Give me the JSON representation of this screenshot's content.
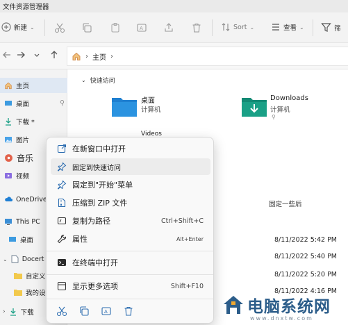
{
  "window": {
    "title": "文件资源管理器"
  },
  "toolbar": {
    "new_label": "新建",
    "sort_label": "Sort",
    "view_label": "查看",
    "filter_label": "筛"
  },
  "address": {
    "crumb": "主页"
  },
  "sidebar": {
    "items": [
      {
        "label": "主页"
      },
      {
        "label": "桌面"
      },
      {
        "label": "下载 *"
      },
      {
        "label": "图片"
      },
      {
        "label": "音乐"
      },
      {
        "label": "视频"
      },
      {
        "label": "OneDrive"
      },
      {
        "label": "This PC"
      },
      {
        "label": "桌面"
      },
      {
        "label": "Docert"
      },
      {
        "label": "自定义"
      },
      {
        "label": "我的设计信息"
      },
      {
        "label": "下载"
      }
    ]
  },
  "main": {
    "section": "快速访问",
    "quick_access": [
      {
        "name": "桌面",
        "sub": "计算机"
      },
      {
        "name": "Downloads",
        "sub": "计算机"
      },
      {
        "name": "Videos"
      }
    ],
    "list_header": "固定一些后",
    "dates": [
      "8/11/2022 5:42 PM",
      "8/11/2022 5:40 PM",
      "8/11/2022 5:20 PM",
      "8/11/2022 4:16 PM"
    ]
  },
  "context_menu": {
    "items": [
      {
        "label": "在新窗口中打开",
        "shortcut": ""
      },
      {
        "label": "固定到快速访问",
        "shortcut": ""
      },
      {
        "label": "固定到\"开始\"菜单",
        "shortcut": ""
      },
      {
        "label": "压缩到 ZIP 文件",
        "shortcut": ""
      },
      {
        "label": "复制为路径",
        "shortcut": "Ctrl+Shift+C"
      },
      {
        "label": "属性",
        "shortcut": "Alt+Enter"
      },
      {
        "label": "在终端中打开",
        "shortcut": ""
      },
      {
        "label": "显示更多选项",
        "shortcut": "Shift+F10"
      }
    ]
  },
  "watermark": {
    "text": "电脑系统网",
    "url": "www.dnxtw.com"
  },
  "colors": {
    "accent": "#0067c0",
    "folder_blue": "#2b8fd6",
    "folder_green": "#1aa086"
  }
}
